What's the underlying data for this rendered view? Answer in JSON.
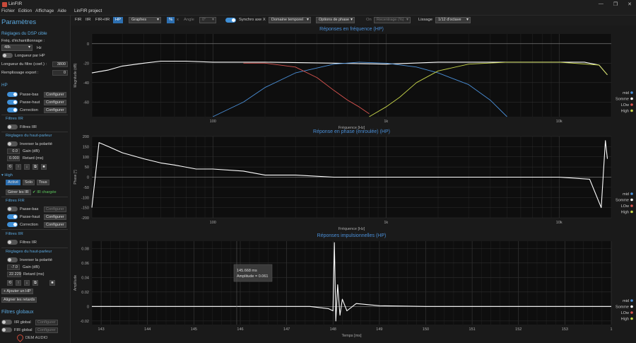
{
  "app": {
    "title": "LinFIR",
    "project_title": "LinFIR project",
    "menus": [
      "Fichier",
      "Edition",
      "Affichage",
      "Aide"
    ],
    "window_controls": [
      "—",
      "❐",
      "✕"
    ]
  },
  "toolbar": {
    "modes": [
      "FIR",
      "IIR",
      "FIR+IIR",
      "HP"
    ],
    "active_mode": "HP",
    "view_select": "Graphes",
    "percent": "%",
    "x_label": "x",
    "angle_label": "Angle",
    "angle_value": "0°",
    "sync_label": "Synchro axe X",
    "domain_select": "Domaine temporel",
    "phase_options": "Options de phase",
    "on_label": "On",
    "recentrage": "Recentrage (%)",
    "lissage_label": "Lissage",
    "lissage_value": "1/12 d'octave"
  },
  "sidebar": {
    "title": "Paramètres",
    "dsp_section": "Réglages du DSP cible",
    "sample_rate_label": "Fréq. d'échantillonnage :",
    "sample_rate": "48k",
    "sample_rate_unit": "Hz",
    "length_per_hp": "Longueur par HP",
    "filter_length_label": "Longueur du filtre (coef.) :",
    "filter_length": "3800",
    "export_fill_label": "Remplissage export :",
    "export_fill": "0",
    "hp_section": "HP",
    "mid_filters": [
      {
        "name": "Passe-bas",
        "btn": "Configurer"
      },
      {
        "name": "Passe-haut",
        "btn": "Configurer"
      },
      {
        "name": "Correction",
        "btn": "Configurer"
      }
    ],
    "iir_section": "Filtres IIR",
    "iir_filters": "Filtres IIR",
    "speaker_settings": "Réglages du haut-parleur",
    "invert_polarity": "Inverser la polarité",
    "mid_gain": "0.0",
    "gain_label": "Gain (dB)",
    "mid_delay": "0.000",
    "delay_label": "Retard (ms)",
    "high_label": "High",
    "high_tabs": [
      "Activé",
      "Solo",
      "Tous"
    ],
    "manage_ir": "Gérer les IR",
    "ir_loaded": "✔ IR chargée",
    "fir_section": "Filtres FIR",
    "high_filters": [
      {
        "name": "Passe-bas",
        "btn": "Configurer"
      },
      {
        "name": "Passe-haut",
        "btn": "Configurer"
      },
      {
        "name": "Correction",
        "btn": "Configurer"
      }
    ],
    "high_gain": "-7.0",
    "high_delay": "22.229",
    "add_hp": "+ Ajouter un HP",
    "align_delays": "Aligner les retards",
    "global_section": "Filtres globaux",
    "global_filters": [
      {
        "name": "IIR global",
        "btn": "Configurer"
      },
      {
        "name": "FIR global",
        "btn": "Configurer"
      }
    ],
    "brand": "DEM AUDIO"
  },
  "legend": {
    "items": [
      "mid",
      "Somme",
      "LOw",
      "High"
    ],
    "colors": [
      "#4a8fd8",
      "#ffffff",
      "#d9534f",
      "#c8d64a"
    ]
  },
  "colors": {
    "accent": "#5ba8de",
    "plot_bg": "#0e0e0e",
    "mid": "#4a8fd8",
    "sum": "#ffffff",
    "low": "#d9534f",
    "high": "#c8d64a"
  },
  "charts": [
    {
      "title": "Réponses en fréquence (HP)",
      "ylabel": "Magnitude (dB)",
      "xlabel": "Fréquence [Hz]",
      "x_ticks": [
        "100",
        "1k",
        "10k"
      ],
      "y_ticks": [
        "0",
        "-20",
        "-40",
        "-60"
      ]
    },
    {
      "title": "Réponse en phase (enroulée) (HP)",
      "ylabel": "Phase [°]",
      "xlabel": "Fréquence [Hz]",
      "x_ticks": [
        "100",
        "1k",
        "10k"
      ],
      "y_ticks": [
        "200",
        "150",
        "100",
        "50",
        "0",
        "-50",
        "-100",
        "-150",
        "-200"
      ]
    },
    {
      "title": "Réponses impulsionnelles (HP)",
      "ylabel": "Amplitude",
      "xlabel": "Temps [ms]",
      "x_ticks": [
        "143",
        "144",
        "145",
        "146",
        "147",
        "148",
        "149",
        "150",
        "151",
        "152",
        "153",
        "1"
      ],
      "y_ticks": [
        "0.08",
        "0.06",
        "0.04",
        "0.02",
        "0",
        "-0.02"
      ],
      "tooltip": {
        "line1": "145.668 ms",
        "line2": "Amplitude = 0.061"
      }
    }
  ],
  "chart_data": [
    {
      "type": "line",
      "title": "Réponses en fréquence (HP)",
      "xlabel": "Fréquence [Hz]",
      "ylabel": "Magnitude (dB)",
      "x_scale": "log",
      "xlim": [
        20,
        20000
      ],
      "ylim": [
        -75,
        10
      ],
      "series": [
        {
          "name": "Somme",
          "x": [
            20,
            25,
            30,
            40,
            50,
            70,
            100,
            200,
            500,
            1000,
            2000,
            5000,
            10000,
            14000,
            17000,
            19000
          ],
          "y": [
            -30,
            -27,
            -23,
            -20,
            -18,
            -18,
            -19,
            -19,
            -20,
            -21,
            -19,
            -19,
            -19,
            -19,
            -22,
            -32
          ]
        },
        {
          "name": "mid",
          "x": [
            100,
            150,
            200,
            300,
            500,
            700,
            1000,
            1500,
            2000,
            3000,
            4000,
            5000
          ],
          "y": [
            -75,
            -60,
            -45,
            -30,
            -21,
            -19,
            -20,
            -24,
            -30,
            -42,
            -58,
            -75
          ]
        },
        {
          "name": "LOw",
          "x": [
            150,
            200,
            300,
            400,
            500,
            600,
            700,
            800
          ],
          "y": [
            -20,
            -20,
            -24,
            -35,
            -48,
            -58,
            -65,
            -72
          ]
        },
        {
          "name": "High",
          "x": [
            800,
            1000,
            1200,
            1500,
            2000,
            3000,
            5000,
            10000,
            17000,
            19000
          ],
          "y": [
            -75,
            -65,
            -55,
            -40,
            -28,
            -21,
            -19,
            -19,
            -22,
            -32
          ]
        }
      ]
    },
    {
      "type": "line",
      "title": "Réponse en phase (enroulée) (HP)",
      "xlabel": "Fréquence [Hz]",
      "ylabel": "Phase [°]",
      "x_scale": "log",
      "xlim": [
        20,
        20000
      ],
      "ylim": [
        -200,
        200
      ],
      "series": [
        {
          "name": "Somme",
          "x": [
            20,
            22,
            25,
            30,
            40,
            50,
            60,
            80,
            100,
            150,
            200,
            300,
            500,
            1000,
            2000,
            5000,
            10000,
            15000,
            17500,
            18500,
            19000
          ],
          "y": [
            -150,
            170,
            150,
            120,
            90,
            70,
            60,
            40,
            40,
            30,
            10,
            10,
            0,
            0,
            0,
            0,
            0,
            -10,
            -150,
            180,
            90
          ]
        }
      ]
    },
    {
      "type": "line",
      "title": "Réponses impulsionnelles (HP)",
      "xlabel": "Temps [ms]",
      "ylabel": "Amplitude",
      "xlim": [
        142.8,
        154
      ],
      "ylim": [
        -0.025,
        0.09
      ],
      "series": [
        {
          "name": "Somme",
          "x": [
            142.8,
            147.5,
            147.9,
            148.0,
            148.03,
            148.06,
            148.1,
            148.15,
            148.2,
            148.3,
            148.5,
            149.0,
            150.0,
            154.0
          ],
          "y": [
            0,
            0,
            -0.003,
            -0.006,
            0.088,
            -0.02,
            0.03,
            -0.012,
            0.01,
            -0.006,
            0.004,
            0.001,
            0,
            0
          ]
        }
      ]
    }
  ]
}
